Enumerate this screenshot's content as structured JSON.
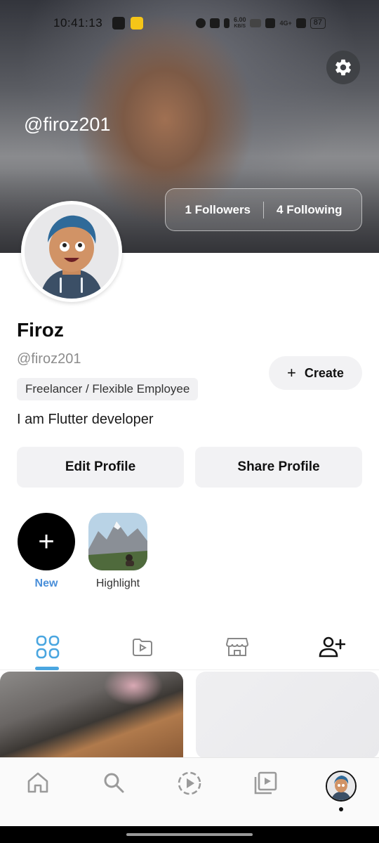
{
  "status_bar": {
    "time": "10:41:13",
    "net_speed": "6.00",
    "net_unit": "KB/S",
    "net_type": "4G+",
    "battery": "87"
  },
  "header": {
    "cover_handle": "@firoz201",
    "followers_label": "1 Followers",
    "following_label": "4 Following"
  },
  "profile": {
    "name": "Firoz",
    "handle": "@firoz201",
    "tag": "Freelancer / Flexible Employee",
    "bio": "I am Flutter developer",
    "create_label": "Create"
  },
  "actions": {
    "edit_label": "Edit Profile",
    "share_label": "Share Profile"
  },
  "highlights": [
    {
      "label": "New",
      "icon": "plus-icon"
    },
    {
      "label": "Highlight",
      "icon": "mountain-image"
    }
  ],
  "tabs": [
    {
      "icon": "grid-icon",
      "active": true
    },
    {
      "icon": "video-play-icon",
      "active": false
    },
    {
      "icon": "store-icon",
      "active": false
    },
    {
      "icon": "add-user-icon",
      "active": false
    }
  ],
  "bottom_nav": [
    {
      "icon": "home-icon"
    },
    {
      "icon": "search-icon"
    },
    {
      "icon": "reels-icon"
    },
    {
      "icon": "video-library-icon"
    },
    {
      "icon": "profile-avatar",
      "active": true
    }
  ],
  "colors": {
    "accent": "#4aa6e0",
    "new_label": "#4a8fd9",
    "button_bg": "#f2f2f4"
  }
}
